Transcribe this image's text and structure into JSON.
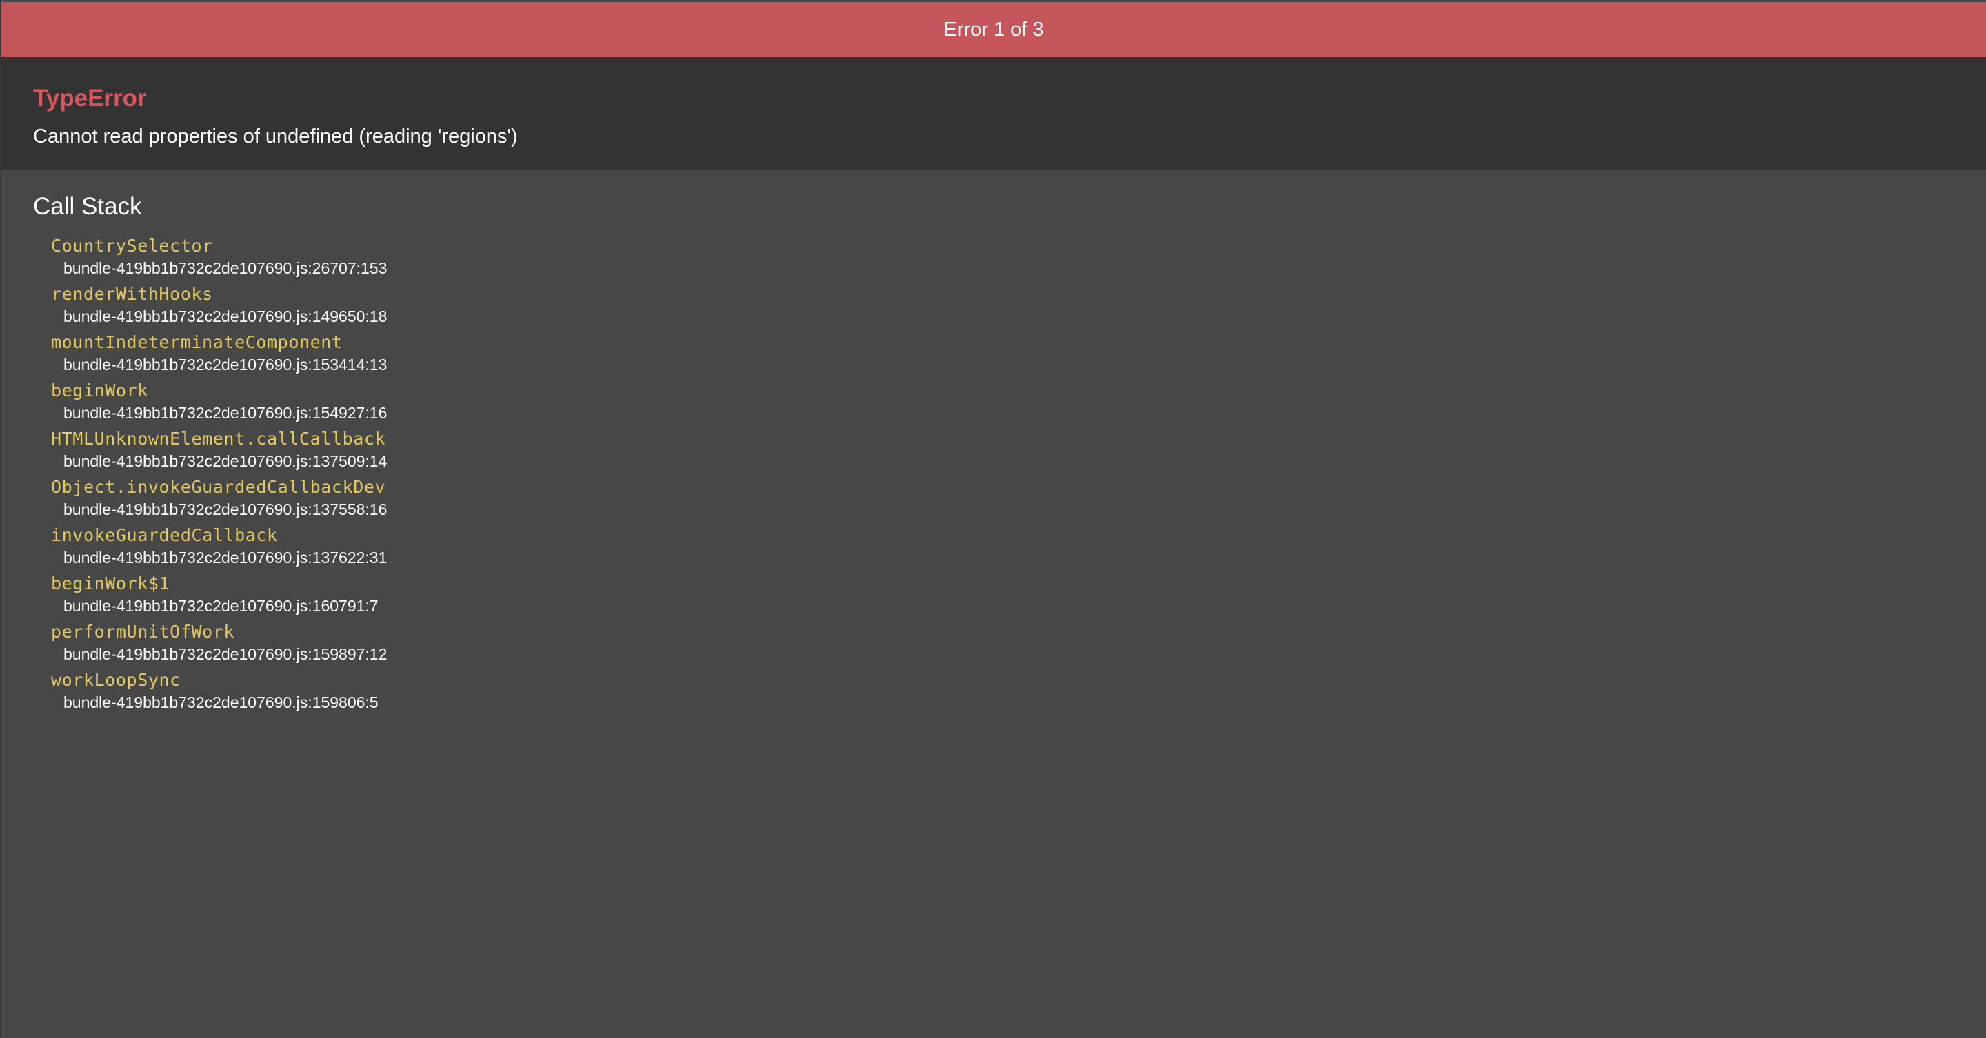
{
  "banner": {
    "text": "Error 1 of 3"
  },
  "error": {
    "type": "TypeError",
    "message": "Cannot read properties of undefined (reading 'regions')"
  },
  "call_stack": {
    "title": "Call Stack",
    "frames": [
      {
        "fn": "CountrySelector",
        "loc": "bundle-419bb1b732c2de107690.js:26707:153"
      },
      {
        "fn": "renderWithHooks",
        "loc": "bundle-419bb1b732c2de107690.js:149650:18"
      },
      {
        "fn": "mountIndeterminateComponent",
        "loc": "bundle-419bb1b732c2de107690.js:153414:13"
      },
      {
        "fn": "beginWork",
        "loc": "bundle-419bb1b732c2de107690.js:154927:16"
      },
      {
        "fn": "HTMLUnknownElement.callCallback",
        "loc": "bundle-419bb1b732c2de107690.js:137509:14"
      },
      {
        "fn": "Object.invokeGuardedCallbackDev",
        "loc": "bundle-419bb1b732c2de107690.js:137558:16"
      },
      {
        "fn": "invokeGuardedCallback",
        "loc": "bundle-419bb1b732c2de107690.js:137622:31"
      },
      {
        "fn": "beginWork$1",
        "loc": "bundle-419bb1b732c2de107690.js:160791:7"
      },
      {
        "fn": "performUnitOfWork",
        "loc": "bundle-419bb1b732c2de107690.js:159897:12"
      },
      {
        "fn": "workLoopSync",
        "loc": "bundle-419bb1b732c2de107690.js:159806:5"
      }
    ]
  }
}
